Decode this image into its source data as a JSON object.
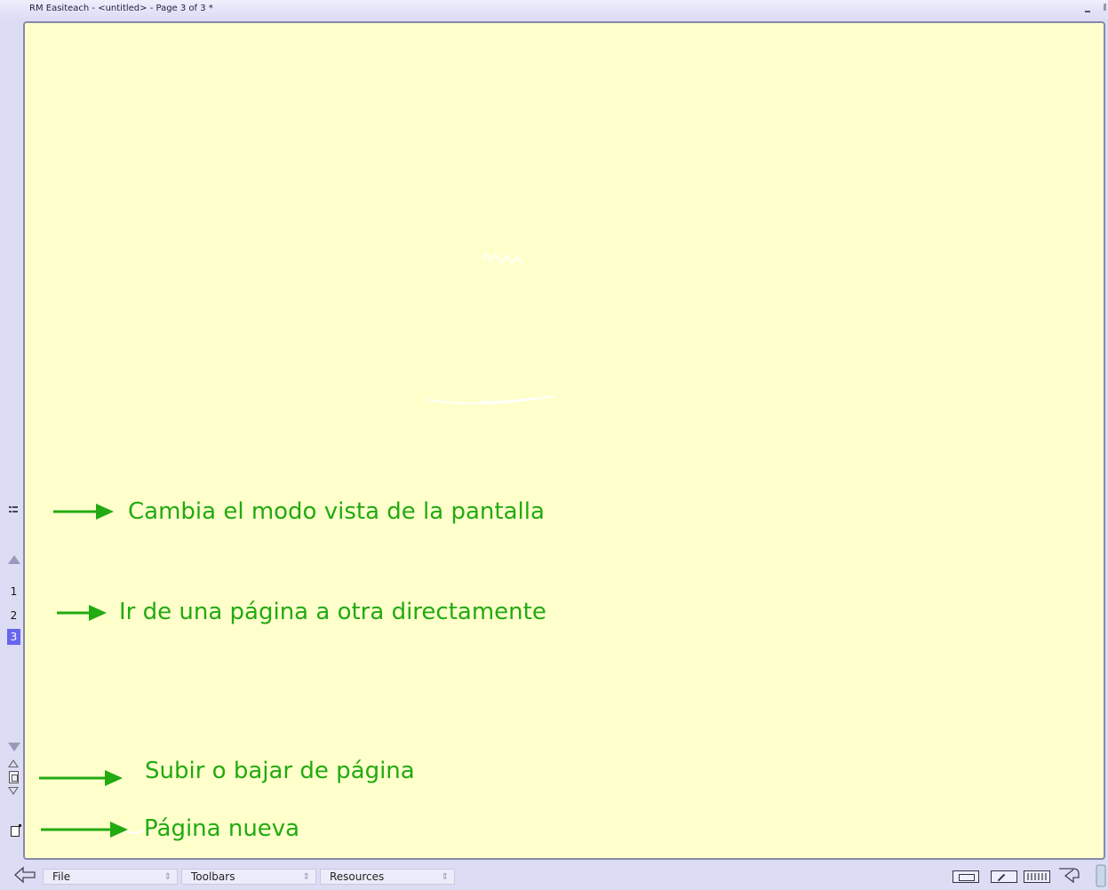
{
  "window": {
    "title": "RM Easiteach - <untitled> - Page 3 of 3 *"
  },
  "sidebar": {
    "view_mode_icon": "grid-view-icon",
    "scroll_up_icon": "triangle-up-icon",
    "pages": [
      {
        "label": "1",
        "active": false
      },
      {
        "label": "2",
        "active": false
      },
      {
        "label": "3",
        "active": true
      }
    ],
    "scroll_down_icon": "triangle-down-icon",
    "page_up_icon": "page-up-icon",
    "page_icon": "page-icon",
    "page_down_icon": "page-down-icon",
    "new_page_icon": "new-page-icon"
  },
  "annotations": [
    {
      "text": "Cambia el modo vista de la pantalla"
    },
    {
      "text": "Ir de una página a otra directamente"
    },
    {
      "text": "Subir o bajar de página"
    },
    {
      "text": "Página nueva"
    }
  ],
  "toolbar": {
    "back_icon": "back-arrow-icon",
    "menus": [
      {
        "label": "File"
      },
      {
        "label": "Toolbars"
      },
      {
        "label": "Resources"
      }
    ],
    "spinner_glyph": "⇕",
    "tools": [
      "ruler-icon",
      "pen-tool-icon",
      "keyboard-icon"
    ],
    "redo_icon": "redo-arrow-icon",
    "trash_icon": "trash-icon"
  },
  "colors": {
    "canvas": "#ffffcc",
    "annotation": "#22aa11",
    "chrome": "#dcdcf4",
    "active_page": "#6666ee"
  }
}
